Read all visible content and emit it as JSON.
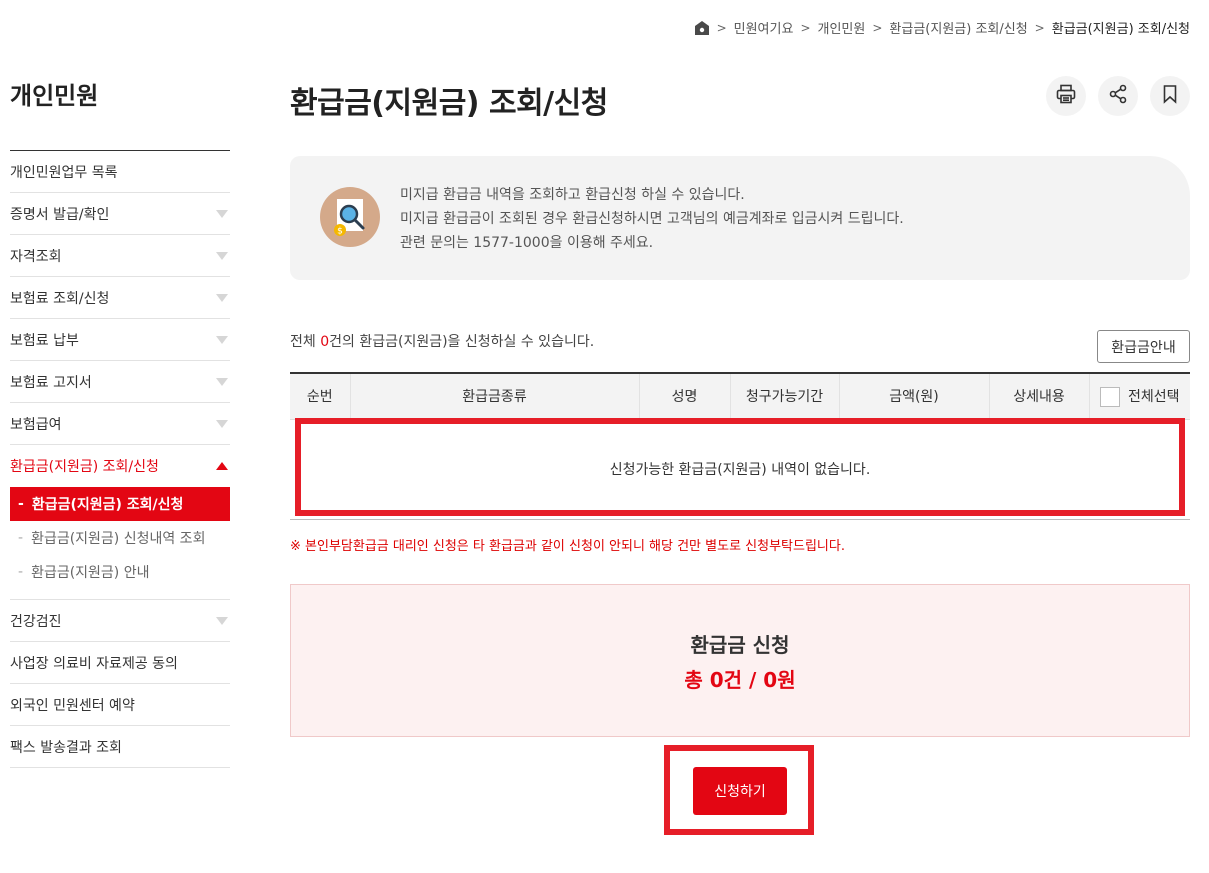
{
  "breadcrumb": {
    "home_icon": "home-icon",
    "items": [
      "민원여기요",
      "개인민원",
      "환급금(지원금) 조회/신청",
      "환급금(지원금) 조회/신청"
    ]
  },
  "sidebar": {
    "title": "개인민원",
    "items": [
      {
        "label": "개인민원업무 목록"
      },
      {
        "label": "증명서 발급/확인"
      },
      {
        "label": "자격조회"
      },
      {
        "label": "보험료 조회/신청"
      },
      {
        "label": "보험료 납부"
      },
      {
        "label": "보험료 고지서"
      },
      {
        "label": "보험급여"
      },
      {
        "label": "환급금(지원금) 조회/신청"
      },
      {
        "label": "건강검진"
      },
      {
        "label": "사업장 의료비 자료제공 동의"
      },
      {
        "label": "외국인 민원센터 예약"
      },
      {
        "label": "팩스 발송결과 조회"
      }
    ],
    "sub_items": [
      {
        "label": "환급금(지원금) 조회/신청"
      },
      {
        "label": "환급금(지원금) 신청내역 조회"
      },
      {
        "label": "환급금(지원금) 안내"
      }
    ],
    "sub_dash": "-"
  },
  "page": {
    "title": "환급금(지원금) 조회/신청",
    "tools": [
      "print-icon",
      "share-icon",
      "bookmark-icon"
    ]
  },
  "info": {
    "icon": "search-document-icon",
    "lines": [
      "미지급 환급금 내역을 조회하고 환급신청 하실 수 있습니다.",
      "미지급 환급금이 조회된 경우 환급신청하시면 고객님의 예금계좌로 입금시켜 드립니다.",
      "관련 문의는 1577-1000을 이용해 주세요."
    ]
  },
  "list": {
    "count_prefix": "전체 ",
    "count": "0",
    "count_suffix": "건의 환급금(지원금)을 신청하실 수 있습니다.",
    "guide_button": "환급금안내",
    "columns": [
      "순번",
      "환급금종류",
      "성명",
      "청구가능기간",
      "금액(원)",
      "상세내용",
      "전체선택"
    ],
    "empty_message": "신청가능한 환급금(지원금) 내역이 없습니다."
  },
  "notice": "※ 본인부담환급금 대리인 신청은 타 환급금과 같이 신청이 안되니 해당 건만 별도로 신청부탁드립니다.",
  "apply": {
    "title": "환급금 신청",
    "total": "총 0건 / 0원",
    "submit_label": "신청하기"
  },
  "colors": {
    "accent": "#e30613",
    "highlight_border": "#e61e28",
    "info_bg": "#f3f3f3",
    "apply_bg": "#fdf1f1"
  }
}
